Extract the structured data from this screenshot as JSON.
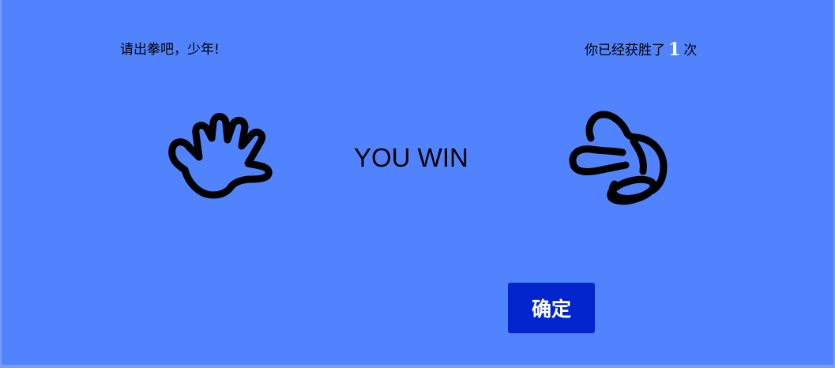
{
  "game": {
    "prompt": "请出拳吧，少年!",
    "wins_prefix": "你已经获胜了",
    "wins_count": "1",
    "wins_suffix": "次",
    "result": "YOU WIN",
    "confirm_label": "确定",
    "player_hand": "paper-hand-icon",
    "computer_hand": "rock-hand-icon"
  },
  "colors": {
    "background": "#5083fd",
    "button": "#0025cc",
    "count": "#ffffff"
  }
}
